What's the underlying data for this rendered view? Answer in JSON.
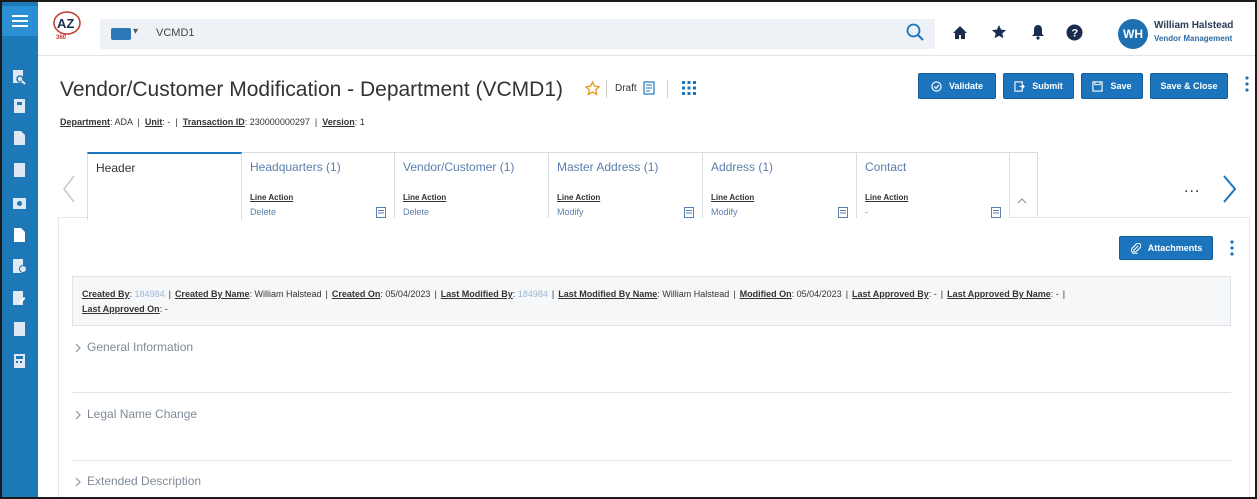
{
  "app": {
    "logo_text": "AZ",
    "logo_sub": "360",
    "workspace_label": "VCMD1",
    "user_initials": "WH",
    "user_name": "William Halstead",
    "user_role": "Vendor Management",
    "brand_color": "#1c75bc",
    "rail_color": "#1d78b8"
  },
  "icons": {
    "rail": [
      "hamburger-menu-icon",
      "search-document-icon",
      "book-icon",
      "document-icon",
      "document-icon",
      "camera-icon",
      "document-icon",
      "document-user-icon",
      "document-edit-icon",
      "document-icon",
      "calculator-icon"
    ],
    "topbar": [
      "search-icon",
      "home-icon",
      "star-icon",
      "bell-icon",
      "help-icon"
    ]
  },
  "page": {
    "title": "Vendor/Customer Modification - Department (VCMD1)",
    "status": "Draft",
    "buttons": {
      "validate": "Validate",
      "submit": "Submit",
      "save": "Save",
      "save_close": "Save & Close"
    },
    "meta": {
      "department_label": "Department",
      "department_value": "ADA",
      "unit_label": "Unit",
      "unit_value": "-",
      "transaction_label": "Transaction ID",
      "transaction_value": "230000000297",
      "version_label": "Version",
      "version_value": "1"
    }
  },
  "tabs": [
    {
      "name": "Header",
      "active": true,
      "line_action_label": "",
      "line_action_value": ""
    },
    {
      "name": "Headquarters (1)",
      "active": false,
      "line_action_label": "Line Action",
      "line_action_value": "Delete"
    },
    {
      "name": "Vendor/Customer (1)",
      "active": false,
      "line_action_label": "Line Action",
      "line_action_value": "Delete"
    },
    {
      "name": "Master Address (1)",
      "active": false,
      "line_action_label": "Line Action",
      "line_action_value": "Modify"
    },
    {
      "name": "Address (1)",
      "active": false,
      "line_action_label": "Line Action",
      "line_action_value": "Modify"
    },
    {
      "name": "Contact",
      "active": false,
      "line_action_label": "Line Action",
      "line_action_value": "-"
    }
  ],
  "tabs_more": "...",
  "attachments_label": "Attachments",
  "audit": {
    "created_by_label": "Created By",
    "created_by": "184984",
    "created_by_name_label": "Created By Name",
    "created_by_name": "William Halstead",
    "created_on_label": "Created On",
    "created_on": "05/04/2023",
    "last_modified_by_label": "Last Modified By",
    "last_modified_by": "184984",
    "last_modified_by_name_label": "Last Modified By Name",
    "last_modified_by_name": "William Halstead",
    "modified_on_label": "Modified On",
    "modified_on": "05/04/2023",
    "last_approved_by_label": "Last Approved By",
    "last_approved_by": "-",
    "last_approved_by_name_label": "Last Approved By Name",
    "last_approved_by_name": "-",
    "last_approved_on_label": "Last Approved On",
    "last_approved_on": "-"
  },
  "sections": [
    {
      "title": "General Information"
    },
    {
      "title": "Legal Name Change"
    },
    {
      "title": "Extended Description"
    }
  ]
}
